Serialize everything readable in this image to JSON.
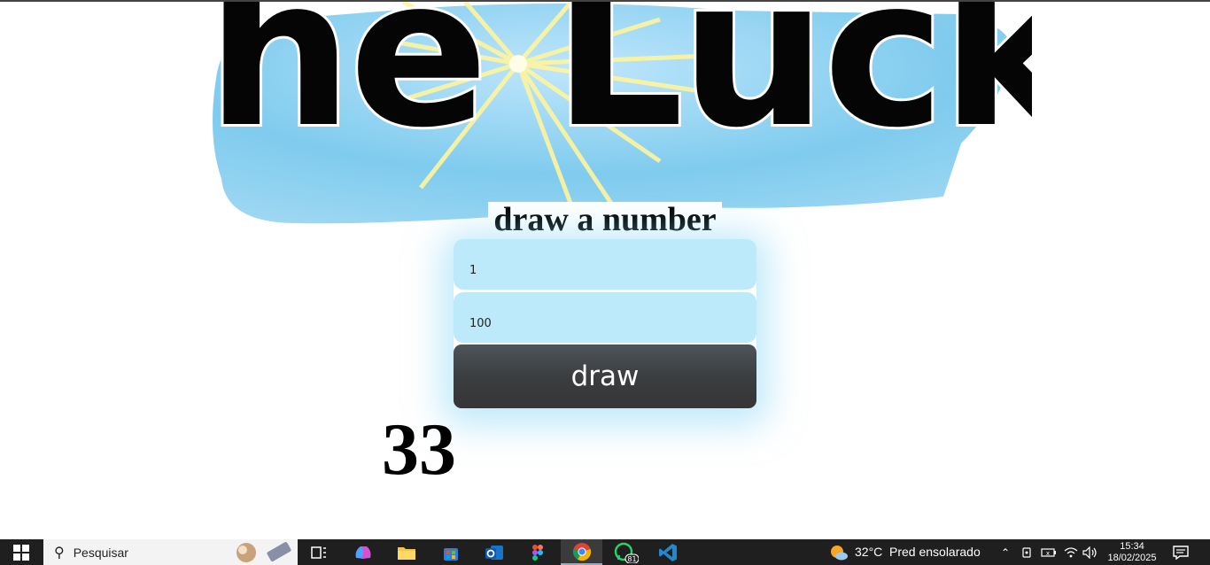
{
  "banner": {
    "logo_text": "he Luck"
  },
  "main": {
    "heading": "draw a number",
    "min_value": "1",
    "max_value": "100",
    "draw_label": "draw",
    "result": "33"
  },
  "taskbar": {
    "search_placeholder": "Pesquisar",
    "apps": [
      "task-view",
      "copilot",
      "file-explorer",
      "microsoft-store",
      "outlook",
      "figma",
      "chrome",
      "whatsapp",
      "vscode"
    ],
    "whatsapp_badge": "81",
    "weather_temp": "32°C",
    "weather_desc": "Pred ensolarado",
    "time": "15:34",
    "date": "18/02/2025"
  },
  "colors": {
    "input_bg": "#bdeafb",
    "button_bg": "#3a3c3e",
    "sky_blue": "#7fcbee",
    "taskbar": "#1f1f1f"
  }
}
